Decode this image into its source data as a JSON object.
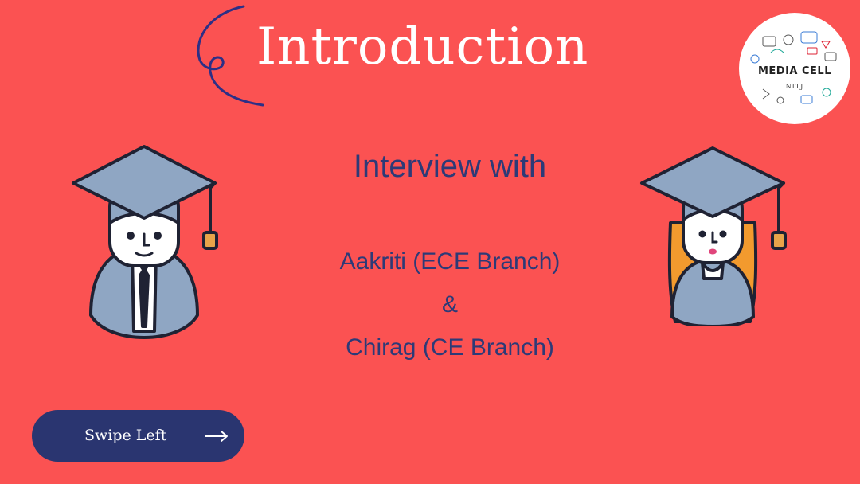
{
  "slide": {
    "title": "Introduction",
    "subtitle": "Interview with",
    "person_1": "Aakriti (ECE Branch)",
    "connector": "&",
    "person_2": "Chirag (CE Branch)"
  },
  "logo": {
    "main_text": "MEDIA CELL",
    "sub_text": "NITJ"
  },
  "swipe_button": {
    "label": "Swipe Left",
    "icon": "right-arrow-icon"
  },
  "colors": {
    "background": "#fb5252",
    "title_text": "#ffffff",
    "body_text": "#2d3a77",
    "button_background": "#2a3570",
    "cap_and_gown": "#8fa6c3",
    "outline": "#1f2233",
    "hair": "#f29a2e"
  },
  "icons": [
    "swirl-decoration-icon",
    "graduate-boy-icon",
    "graduate-girl-icon",
    "media-cell-logo",
    "right-arrow-icon"
  ]
}
